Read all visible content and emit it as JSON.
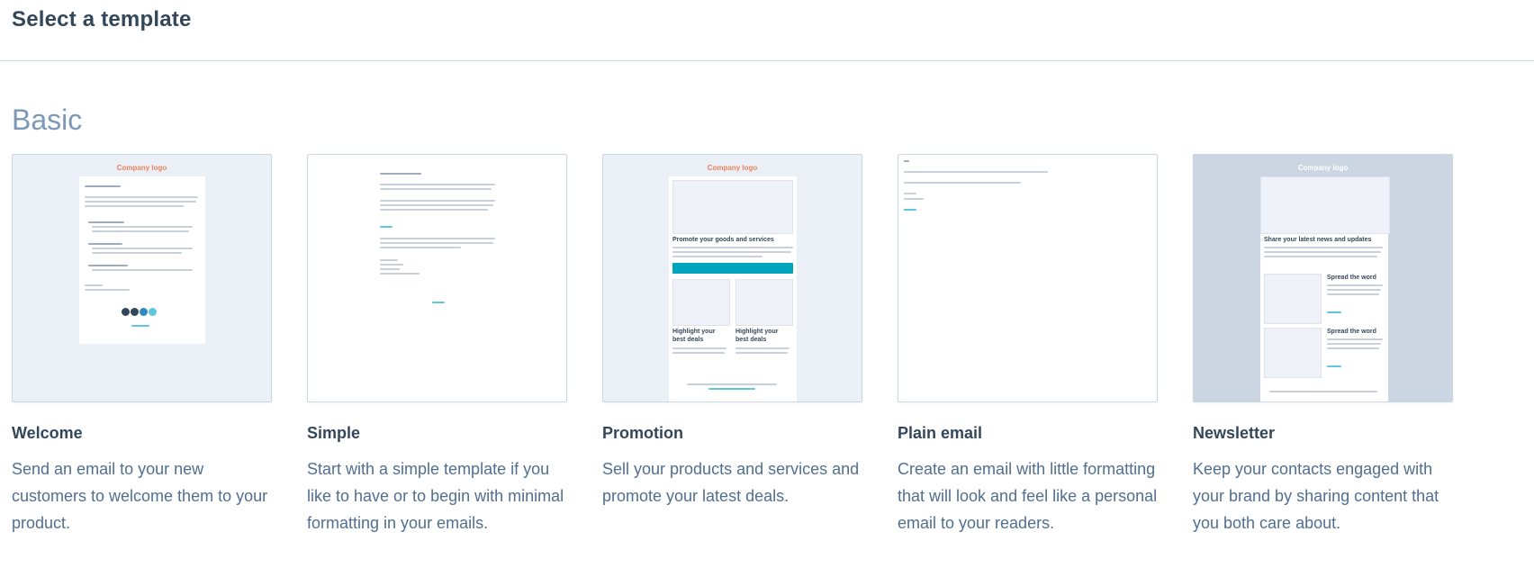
{
  "page": {
    "title": "Select a template",
    "section": "Basic"
  },
  "templates": [
    {
      "name": "Welcome",
      "description": "Send an email to your new customers to welcome them to your product.",
      "preview_logo": "Company logo"
    },
    {
      "name": "Simple",
      "description": "Start with a simple template if you like to have or to begin with minimal formatting in your emails."
    },
    {
      "name": "Promotion",
      "description": "Sell your products and services and promote your latest deals.",
      "preview_logo": "Company logo",
      "preview_heading": "Promote your goods and services",
      "preview_sub_heading_1": "Highlight your best deals",
      "preview_sub_heading_2": "Highlight your best deals"
    },
    {
      "name": "Plain email",
      "description": "Create an email with little formatting that will look and feel like a personal email to your readers."
    },
    {
      "name": "Newsletter",
      "description": "Keep your contacts engaged with your brand by sharing content that you both care about.",
      "preview_logo": "Company logo",
      "preview_heading": "Share your latest news and updates",
      "preview_item_heading_1": "Spread the word",
      "preview_item_heading_2": "Spread the word"
    }
  ],
  "colors": {
    "accent": "#00a4bd",
    "logo": "#f2805e",
    "heading": "#33475b",
    "muted": "#7c98b6",
    "border": "#cbd6e2"
  }
}
